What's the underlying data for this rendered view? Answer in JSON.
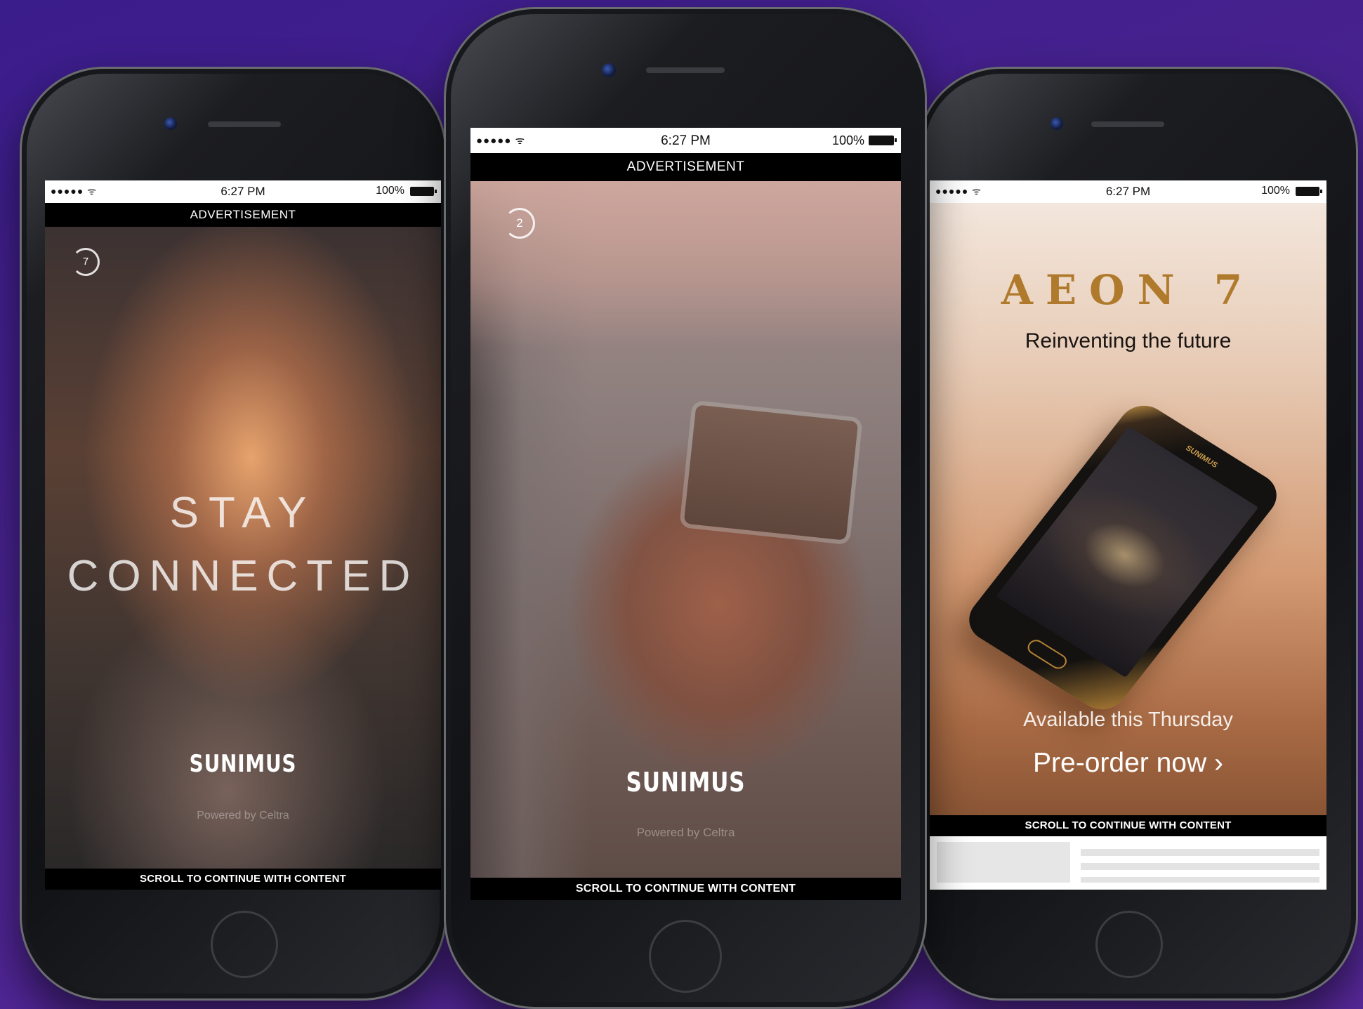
{
  "status": {
    "signal": "●●●●● ᯤ",
    "time": "6:27 PM",
    "battery": "100%"
  },
  "phones": [
    {
      "ad_label": "ADVERTISEMENT",
      "timer": "7",
      "headline_line1": "STAY",
      "headline_line2": "CONNECTED",
      "brand": "SUNIMUS",
      "powered": "Powered by Celtra",
      "scroll_label": "SCROLL TO CONTINUE WITH CONTENT"
    },
    {
      "ad_label": "ADVERTISEMENT",
      "timer": "2",
      "brand": "SUNIMUS",
      "powered": "Powered by Celtra",
      "scroll_label": "SCROLL TO CONTINUE WITH CONTENT"
    },
    {
      "product_title": "AEON 7",
      "tagline": "Reinventing the future",
      "device_brand": "SUNIMUS",
      "availability": "Available this Thursday",
      "cta": "Pre-order now ›",
      "scroll_label": "SCROLL TO CONTINUE WITH CONTENT"
    }
  ]
}
